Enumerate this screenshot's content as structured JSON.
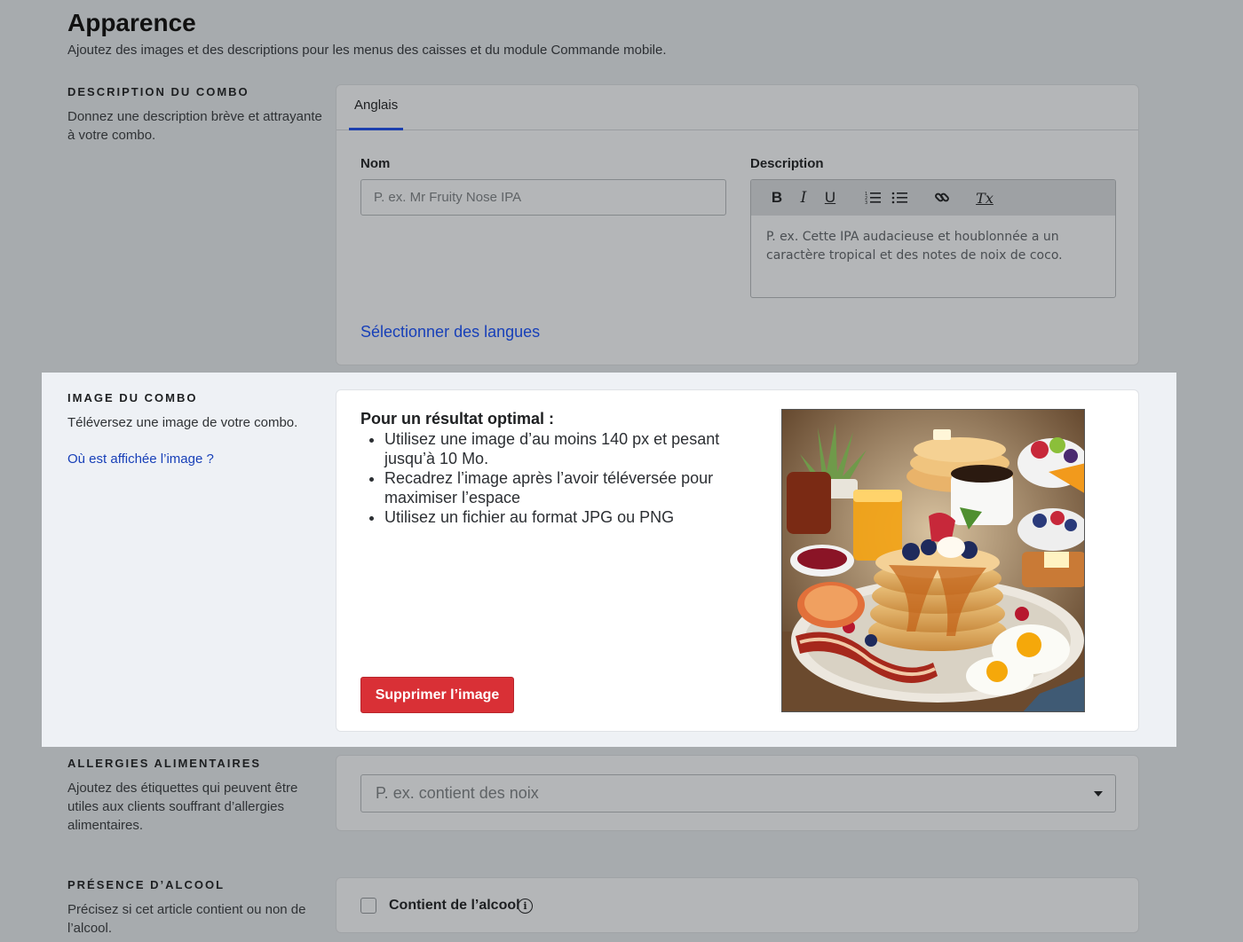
{
  "header": {
    "title": "Apparence",
    "subtitle": "Ajoutez des images et des descriptions pour les menus des caisses et du module Commande mobile."
  },
  "description_section": {
    "heading": "DESCRIPTION DU COMBO",
    "desc": "Donnez une description brève et attrayante à votre combo.",
    "tab_label": "Anglais",
    "name_label": "Nom",
    "name_placeholder": "P. ex. Mr Fruity Nose IPA",
    "description_label": "Description",
    "toolbar": {
      "bold": "B",
      "italic": "I",
      "underline": "U",
      "clear": "Tx"
    },
    "description_placeholder": "P. ex. Cette IPA audacieuse et houblonnée a un caractère tropical et des notes de noix de coco.",
    "languages_link": "Sélectionner des langues"
  },
  "image_section": {
    "heading": "IMAGE DU COMBO",
    "desc": "Téléversez une image de votre combo.",
    "link": "Où est affichée l’image ?",
    "optimal_title": "Pour un résultat optimal :",
    "tips": [
      "Utilisez une image d’au moins 140 px et pesant jusqu’à 10 Mo.",
      "Recadrez l’image après l’avoir téléversée pour maximiser l’espace",
      "Utilisez un fichier au format JPG ou PNG"
    ],
    "delete_button": "Supprimer l’image"
  },
  "allergy_section": {
    "heading": "ALLERGIES ALIMENTAIRES",
    "desc": "Ajoutez des étiquettes qui peuvent être utiles aux clients souffrant d’allergies alimentaires.",
    "select_placeholder": "P. ex. contient des noix"
  },
  "alcohol_section": {
    "heading": "PRÉSENCE D’ALCOOL",
    "desc": "Précisez si cet article contient ou non de l’alcool.",
    "checkbox_label": "Contient de l’alcool",
    "info_icon_glyph": "i"
  },
  "colors": {
    "accent": "#1c3fae",
    "link": "#1840b8",
    "danger": "#d93036"
  }
}
